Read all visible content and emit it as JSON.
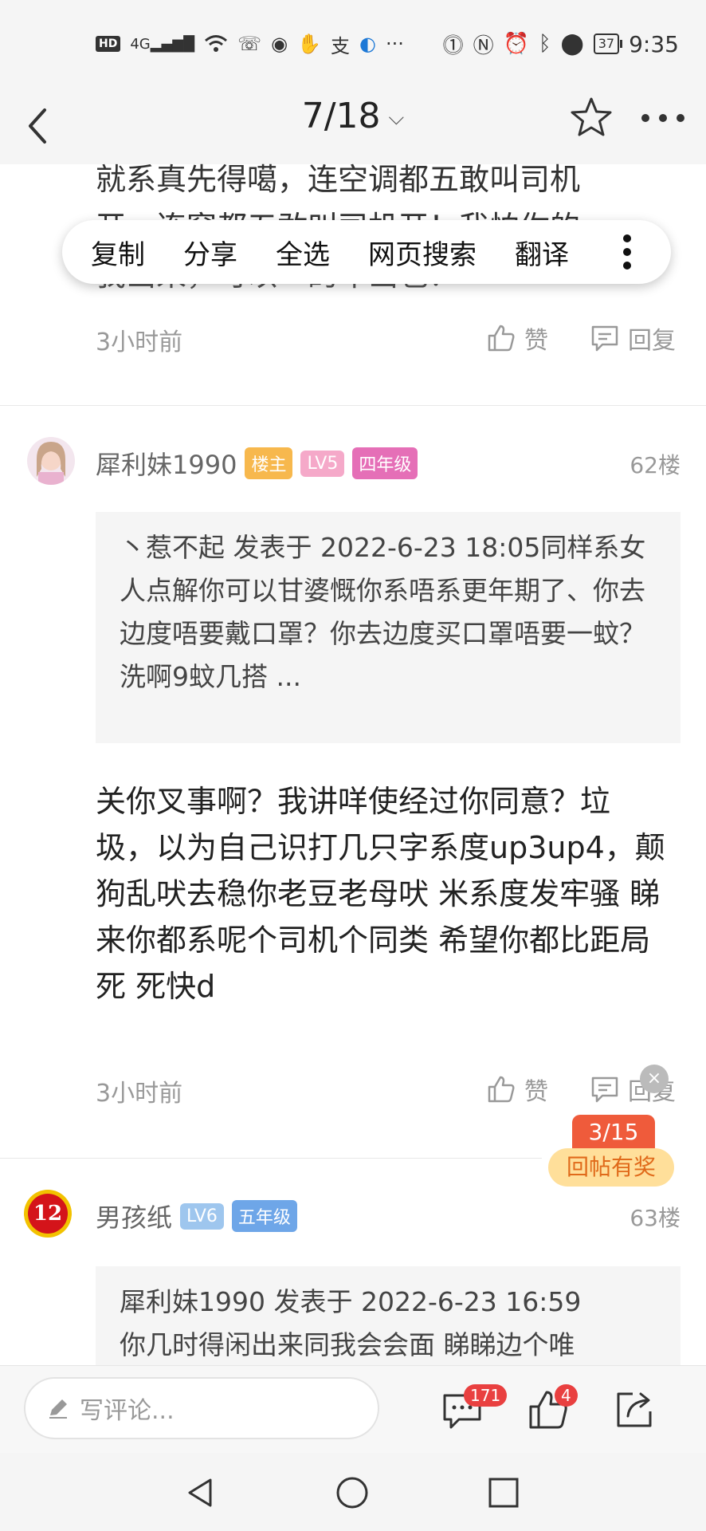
{
  "status_bar": {
    "network": "4G",
    "hd": "HD",
    "battery": "37",
    "time": "9:35"
  },
  "nav": {
    "page_indicator": "7/18"
  },
  "context_menu": {
    "items": [
      "复制",
      "分享",
      "全选",
      "网页搜索",
      "翻译"
    ]
  },
  "prev_post": {
    "line1": "就系真先得噶，连空调都五敢叫司机",
    "line2": "开，连窗都五敢叫司机开！我怕你的",
    "line3": "我出来，可以一的车出也？",
    "time": "3小时前",
    "like_label": "赞",
    "reply_label": "回复"
  },
  "post62": {
    "username": "犀利妹1990",
    "badges": [
      "楼主",
      "LV5",
      "四年级"
    ],
    "floor": "62楼",
    "quote": "丶惹不起 发表于 2022-6-23 18:05同样系女人点解你可以甘婆慨你系唔系更年期了、你去边度唔要戴口罩？你去边度买口罩唔要一蚊？洗啊9蚊几搭 ...",
    "body": "关你叉事啊？我讲咩使经过你同意？垃圾，以为自己识打几只字系度up3up4，颠狗乱吠去稳你老豆老母吠 米系度发牢骚 睇来你都系呢个司机个同类 希望你都比距局死 死快d",
    "time": "3小时前",
    "like_label": "赞",
    "reply_label": "回复"
  },
  "floating": {
    "close": "×",
    "count": "3/15",
    "reward": "回帖有奖"
  },
  "post63": {
    "avatar_text": "12",
    "username": "男孩纸",
    "badges": [
      "LV6",
      "五年级"
    ],
    "floor": "63楼",
    "quote_line1": "犀利妹1990 发表于 2022-6-23 16:59",
    "quote_line2": "你几时得闲出来同我会会面 睇睇边个唯"
  },
  "bottom_bar": {
    "comment_placeholder": "写评论...",
    "comment_count": "171",
    "like_count": "4"
  },
  "colors": {
    "owner_badge": "#f7b84d",
    "lv5_badge": "#f5a9c9",
    "grade4_badge": "#e56fb7",
    "lv6_badge": "#9ec6ee",
    "grade5_badge": "#6ea6e8",
    "count_pill": "#ef5b3b",
    "reward_bg": "#ffdf9a",
    "reward_text": "#e06a1a",
    "red_badge": "#e94040"
  }
}
